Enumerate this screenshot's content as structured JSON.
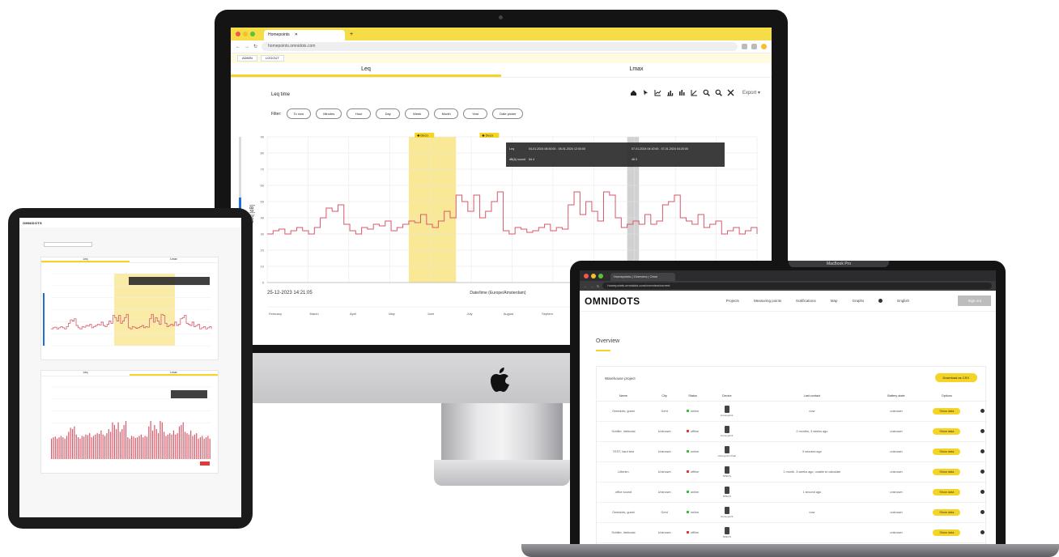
{
  "imac": {
    "browser": {
      "tab_title": "Homepoints",
      "address": "homepoints.omnidots.com"
    },
    "crumbs": [
      "ADMIN",
      "LOGOUT"
    ],
    "app_tabs": [
      "Leq",
      "Lmax"
    ],
    "chart_title": "Leq time",
    "filter_label": "Filter:",
    "filters": [
      "To now",
      "Minutes",
      "Hour",
      "Day",
      "Week",
      "Month",
      "Year",
      "Date picker"
    ],
    "export_label": "Export",
    "annotations": [
      "Deco",
      "Deco"
    ],
    "tooltip": {
      "rows": [
        [
          "Leq",
          "04-01-2024 08:30:00 - 05-01-2024 12:00:00",
          "07-01-2024 04:10:00 - 07-01-2024 04:20:00"
        ],
        [
          "dB(A) sound",
          "54.4",
          "46.3"
        ]
      ]
    },
    "y_axis_label": "Leq [dB]",
    "current_time": "25-12-2023 14:21:05",
    "x_axis_title": "Date/time (Europe/Amsterdam)",
    "months": [
      "February",
      "March",
      "April",
      "May",
      "June",
      "July",
      "August",
      "Septem"
    ]
  },
  "ipad": {
    "logo": "OMNIDOTS",
    "card1_tabs": [
      "Leq",
      "Lmax"
    ],
    "card2_tabs": [
      "Leq",
      "Lmax"
    ]
  },
  "macbook": {
    "browser": {
      "tab_title": "Homepoints | Overview | Omni",
      "address": "homepoints.omnidots.com/overview/current"
    },
    "logo": "OMNIDOTS",
    "nav": [
      "Projects",
      "Measuring points",
      "Notifications",
      "Map",
      "Graphs"
    ],
    "lang": "English",
    "signout": "Sign out",
    "page_title": "Overview",
    "project_title": "Warehouse project",
    "download_label": "Download as CSV",
    "columns": [
      "Name",
      "City",
      "Status",
      "Device",
      "Last contact",
      "Battery state",
      "Options"
    ],
    "rows": [
      {
        "name": "Omnidots, guest",
        "city": "Gent",
        "status": "online",
        "device": "Honeypoint",
        "contact": "now",
        "battery": "unknown",
        "action": "Show data"
      },
      {
        "name": "Schiller, Idetrodai",
        "city": "Unknown",
        "status": "offline",
        "device": "Honeypoint",
        "contact": "2 months, 3 weeks ago",
        "battery": "unknown",
        "action": "Show data"
      },
      {
        "name": "TEST, hard test",
        "city": "Unknown",
        "status": "online",
        "device": "Honeypoint Dual",
        "contact": "3 minutes ago",
        "battery": "unknown",
        "action": "Show data"
      },
      {
        "name": "Lifterlen",
        "city": "Unknown",
        "status": "offline",
        "device": "SPECS",
        "contact": "1 month, 3 weeks ago, unable to calculate",
        "battery": "unknown",
        "action": "Show data"
      },
      {
        "name": "office sound",
        "city": "Unknown",
        "status": "online",
        "device": "SPECS",
        "contact": "1 second ago",
        "battery": "unknown",
        "action": "Show data"
      },
      {
        "name": "Omnidots, guest",
        "city": "Gent",
        "status": "online",
        "device": "Honeypoint",
        "contact": "now",
        "battery": "unknown",
        "action": "Show data"
      },
      {
        "name": "Schiller, Idetrodai",
        "city": "Unknown",
        "status": "offline",
        "device": "SPECS",
        "contact": "",
        "battery": "unknown",
        "action": "Show data"
      }
    ],
    "model_label": "MacBook Pro"
  },
  "chart_data": {
    "type": "line",
    "title": "Leq time",
    "ylabel": "Leq [dB]",
    "xlabel": "Date/time (Europe/Amsterdam)",
    "ylim": [
      0,
      90
    ],
    "series": [
      {
        "name": "Leq",
        "values": [
          30,
          32,
          33,
          30,
          32,
          34,
          32,
          30,
          34,
          40,
          46,
          44,
          48,
          36,
          32,
          30,
          34,
          33,
          36,
          35,
          38,
          32,
          34,
          36,
          38,
          37,
          42,
          36,
          34,
          38,
          44,
          40,
          54,
          50,
          44,
          54,
          40,
          44,
          50,
          56,
          32,
          30,
          34,
          33,
          31,
          32,
          34,
          36,
          32,
          34,
          33,
          48,
          56,
          42,
          50,
          44,
          38,
          56,
          54,
          40,
          34,
          36,
          38,
          36,
          42,
          36,
          38,
          48,
          50,
          54,
          40,
          38,
          36,
          42,
          34,
          36,
          38,
          30,
          32,
          34,
          30,
          32,
          34,
          30
        ]
      }
    ]
  }
}
